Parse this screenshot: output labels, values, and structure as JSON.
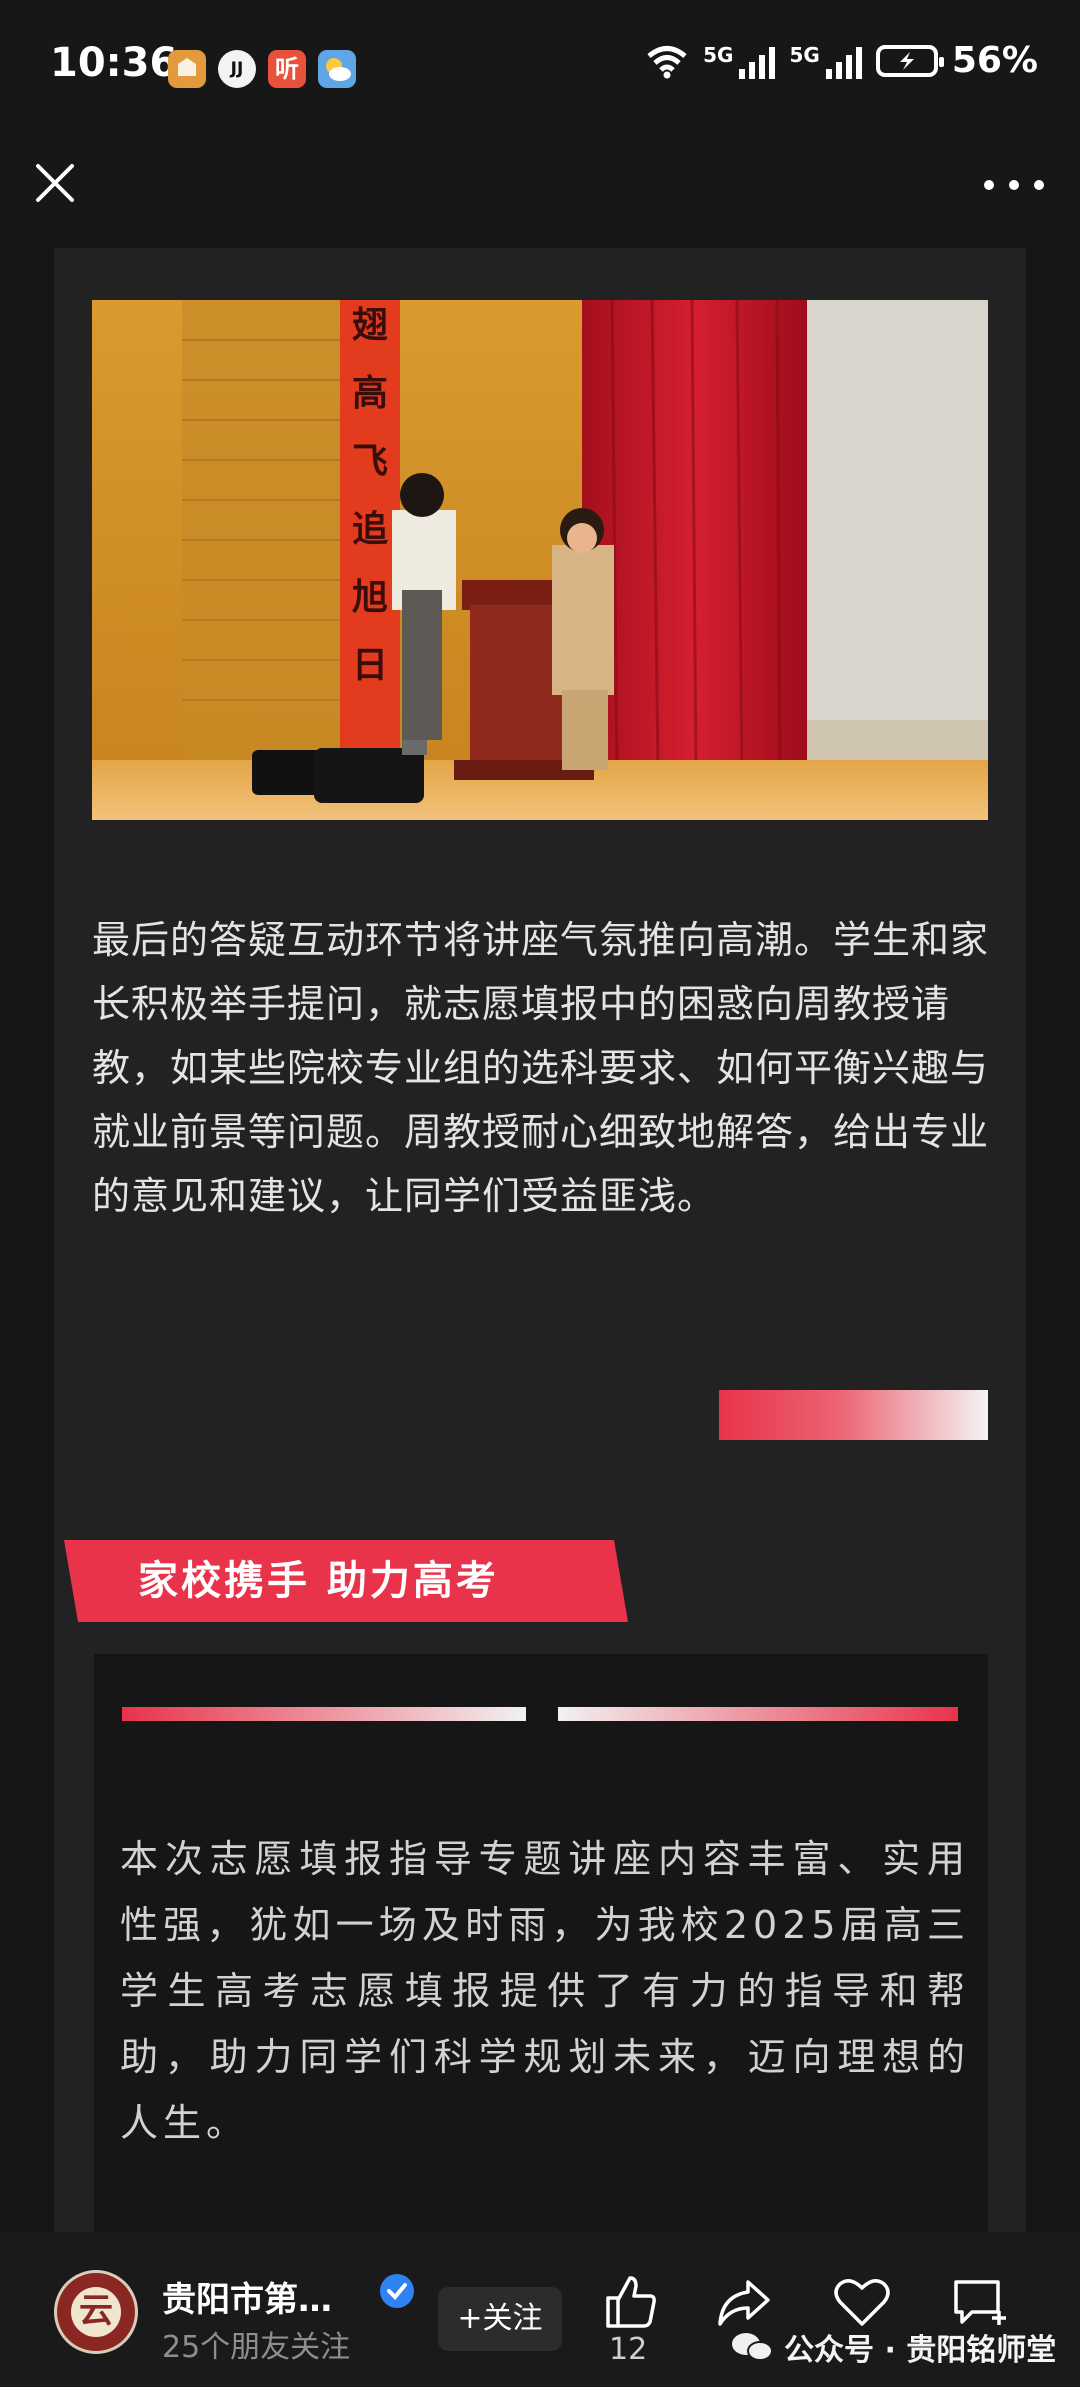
{
  "status_bar": {
    "time": "10:36",
    "network_1": "5G",
    "network_2": "5G",
    "battery": "56%",
    "app_icons": [
      "game-app-icon",
      "jr-app-icon",
      "ting-app-icon",
      "weather-app-icon"
    ],
    "ting_glyph": "听",
    "jr_glyph": "JJ"
  },
  "header": {
    "close_icon": "close-icon",
    "more_icon": "more-dots-icon"
  },
  "article": {
    "photo_banner_text": [
      "翅",
      "高",
      "飞",
      "追",
      "旭",
      "日"
    ],
    "paragraph_1": "最后的答疑互动环节将讲座气氛推向高潮。学生和家长积极举手提问，就志愿填报中的困惑向周教授请教，如某些院校专业组的选科要求、如何平衡兴趣与就业前景等问题。周教授耐心细致地解答，给出专业的意见和建议，让同学们受益匪浅。",
    "section_title": "家校携手  助力高考",
    "paragraph_2": "本次志愿填报指导专题讲座内容丰富、实用性强，犹如一场及时雨，为我校2025届高三学生高考志愿填报提供了有力的指导和帮助，助力同学们科学规划未来，迈向理想的人生。"
  },
  "bottom_bar": {
    "avatar_glyph": "云",
    "account_name": "贵阳市第…",
    "follower_text": "25个朋友关注",
    "follow_label": "+关注",
    "like_count": "12",
    "watermark": "公众号 · 贵阳铭师堂"
  },
  "colors": {
    "accent_red": "#e8334a",
    "background": "#161616",
    "card": "#222222",
    "verified_blue": "#2f82f2"
  }
}
